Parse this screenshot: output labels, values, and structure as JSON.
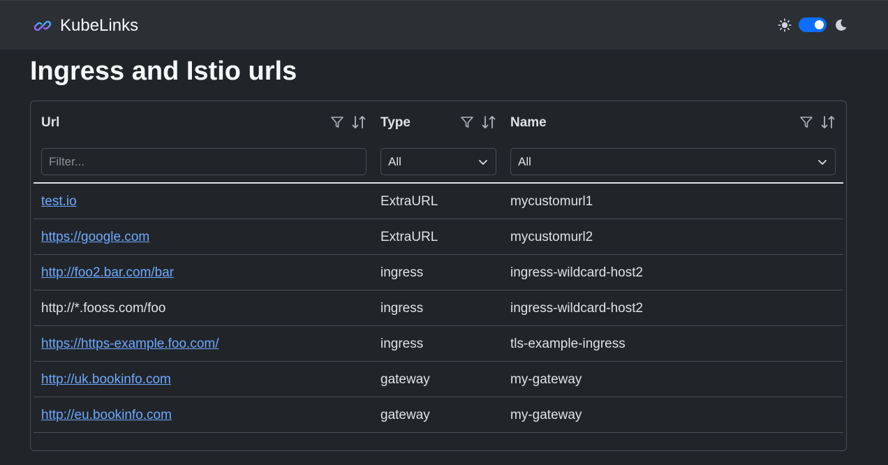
{
  "app": {
    "brand": "KubeLinks",
    "theme_toggle_on": true
  },
  "page": {
    "title": "Ingress and Istio urls"
  },
  "table": {
    "columns": [
      {
        "label": "Url"
      },
      {
        "label": "Type"
      },
      {
        "label": "Name"
      }
    ],
    "filters": {
      "url_placeholder": "Filter...",
      "url_value": "",
      "type_value": "All",
      "name_value": "All"
    },
    "rows": [
      {
        "url": "test.io",
        "url_is_link": true,
        "type": "ExtraURL",
        "name": "mycustomurl1"
      },
      {
        "url": "https://google.com",
        "url_is_link": true,
        "type": "ExtraURL",
        "name": "mycustomurl2"
      },
      {
        "url": "http://foo2.bar.com/bar",
        "url_is_link": true,
        "type": "ingress",
        "name": "ingress-wildcard-host2"
      },
      {
        "url": "http://*.fooss.com/foo",
        "url_is_link": false,
        "type": "ingress",
        "name": "ingress-wildcard-host2"
      },
      {
        "url": "https://https-example.foo.com/",
        "url_is_link": true,
        "type": "ingress",
        "name": "tls-example-ingress"
      },
      {
        "url": "http://uk.bookinfo.com",
        "url_is_link": true,
        "type": "gateway",
        "name": "my-gateway"
      },
      {
        "url": "http://eu.bookinfo.com",
        "url_is_link": true,
        "type": "gateway",
        "name": "my-gateway"
      }
    ]
  },
  "colors": {
    "background": "#212529",
    "navbar": "#2b3035",
    "accent": "#0d6efd",
    "link": "#6ea8fe"
  },
  "icons": {
    "logo": "link-icon",
    "light": "sun-icon",
    "dark": "moon-icon",
    "filter": "funnel-icon",
    "sort": "sort-arrows-icon",
    "dropdown": "chevron-down-icon"
  }
}
